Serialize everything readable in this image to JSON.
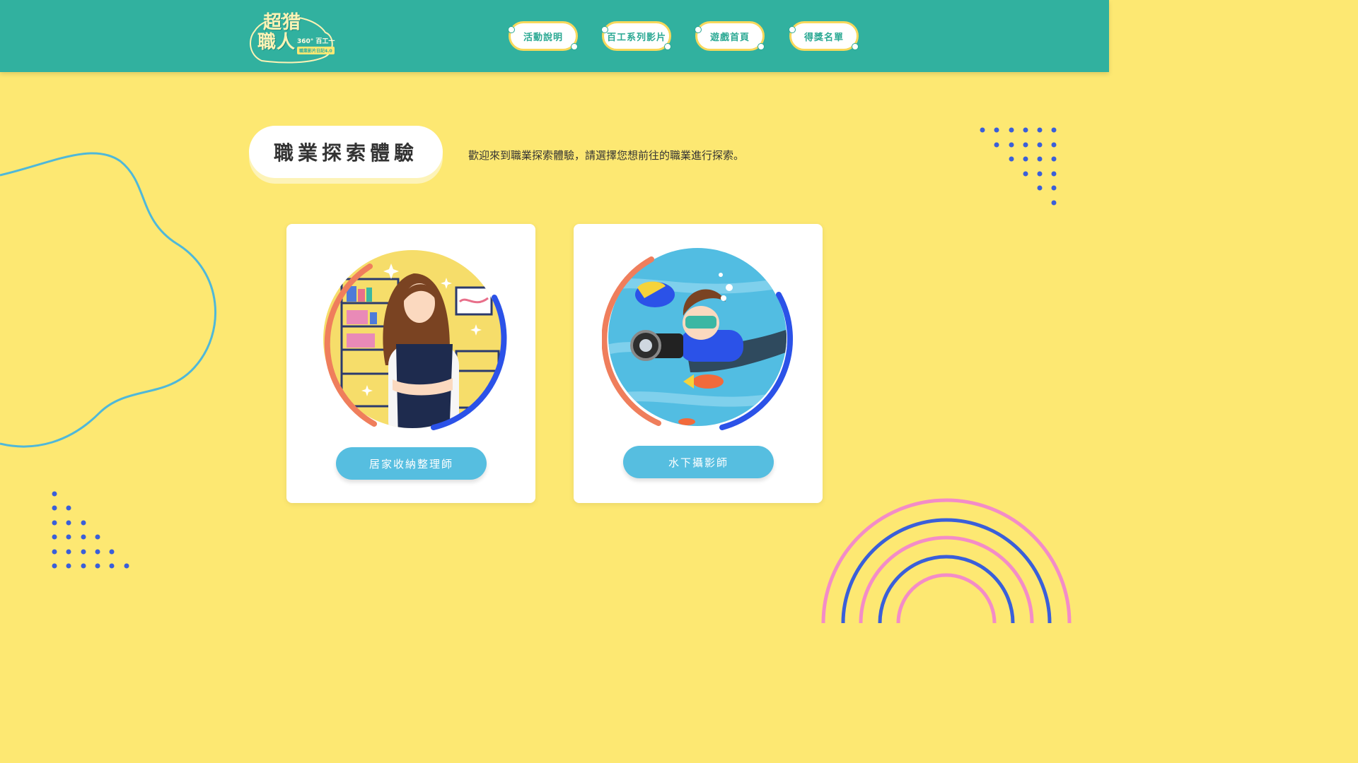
{
  "logo": {
    "title_line1": "超猎",
    "title_line2": "職人",
    "subtitle": "360° 百工一日",
    "tag": "職業影片日記4.0"
  },
  "nav": [
    {
      "label": "活動說明"
    },
    {
      "label": "百工系列影片"
    },
    {
      "label": "遊戲首頁"
    },
    {
      "label": "得獎名單"
    }
  ],
  "section": {
    "title": "職業探索體驗",
    "intro": "歡迎來到職業探索體驗，請選擇您想前往的職業進行探索。"
  },
  "cards": [
    {
      "button_label": "居家收納整理師",
      "illustration": "home-organizer-illustration"
    },
    {
      "button_label": "水下攝影師",
      "illustration": "underwater-photographer-illustration"
    }
  ],
  "colors": {
    "background": "#fde872",
    "header": "#31b19f",
    "button": "#56bee0",
    "ring_orange": "#ef7e5c",
    "ring_blue": "#2b52e8",
    "wave_line": "#4fb8d9",
    "dots": "#3a5fd9",
    "rainbow_pink": "#f38cc7",
    "rainbow_blue": "#3a5fd9"
  }
}
